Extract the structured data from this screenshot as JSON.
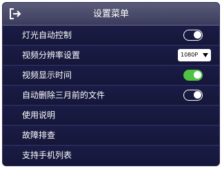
{
  "header": {
    "title": "设置菜单",
    "exit_icon": "exit-icon"
  },
  "menu": {
    "items": [
      {
        "label": "灯光自动控制",
        "control": "toggle",
        "state": "off"
      },
      {
        "label": "视频分辨率设置",
        "control": "select",
        "value": "1080P"
      },
      {
        "label": "视频显示时间",
        "control": "toggle",
        "state": "on"
      },
      {
        "label": "自动删除三月前的文件",
        "control": "toggle",
        "state": "off"
      },
      {
        "label": "使用说明"
      },
      {
        "label": "故障排查"
      },
      {
        "label": "支持手机列表"
      }
    ]
  },
  "colors": {
    "background": "#1a1b45",
    "header": "#4a4b6b",
    "toggle_on": "#4fc442"
  }
}
